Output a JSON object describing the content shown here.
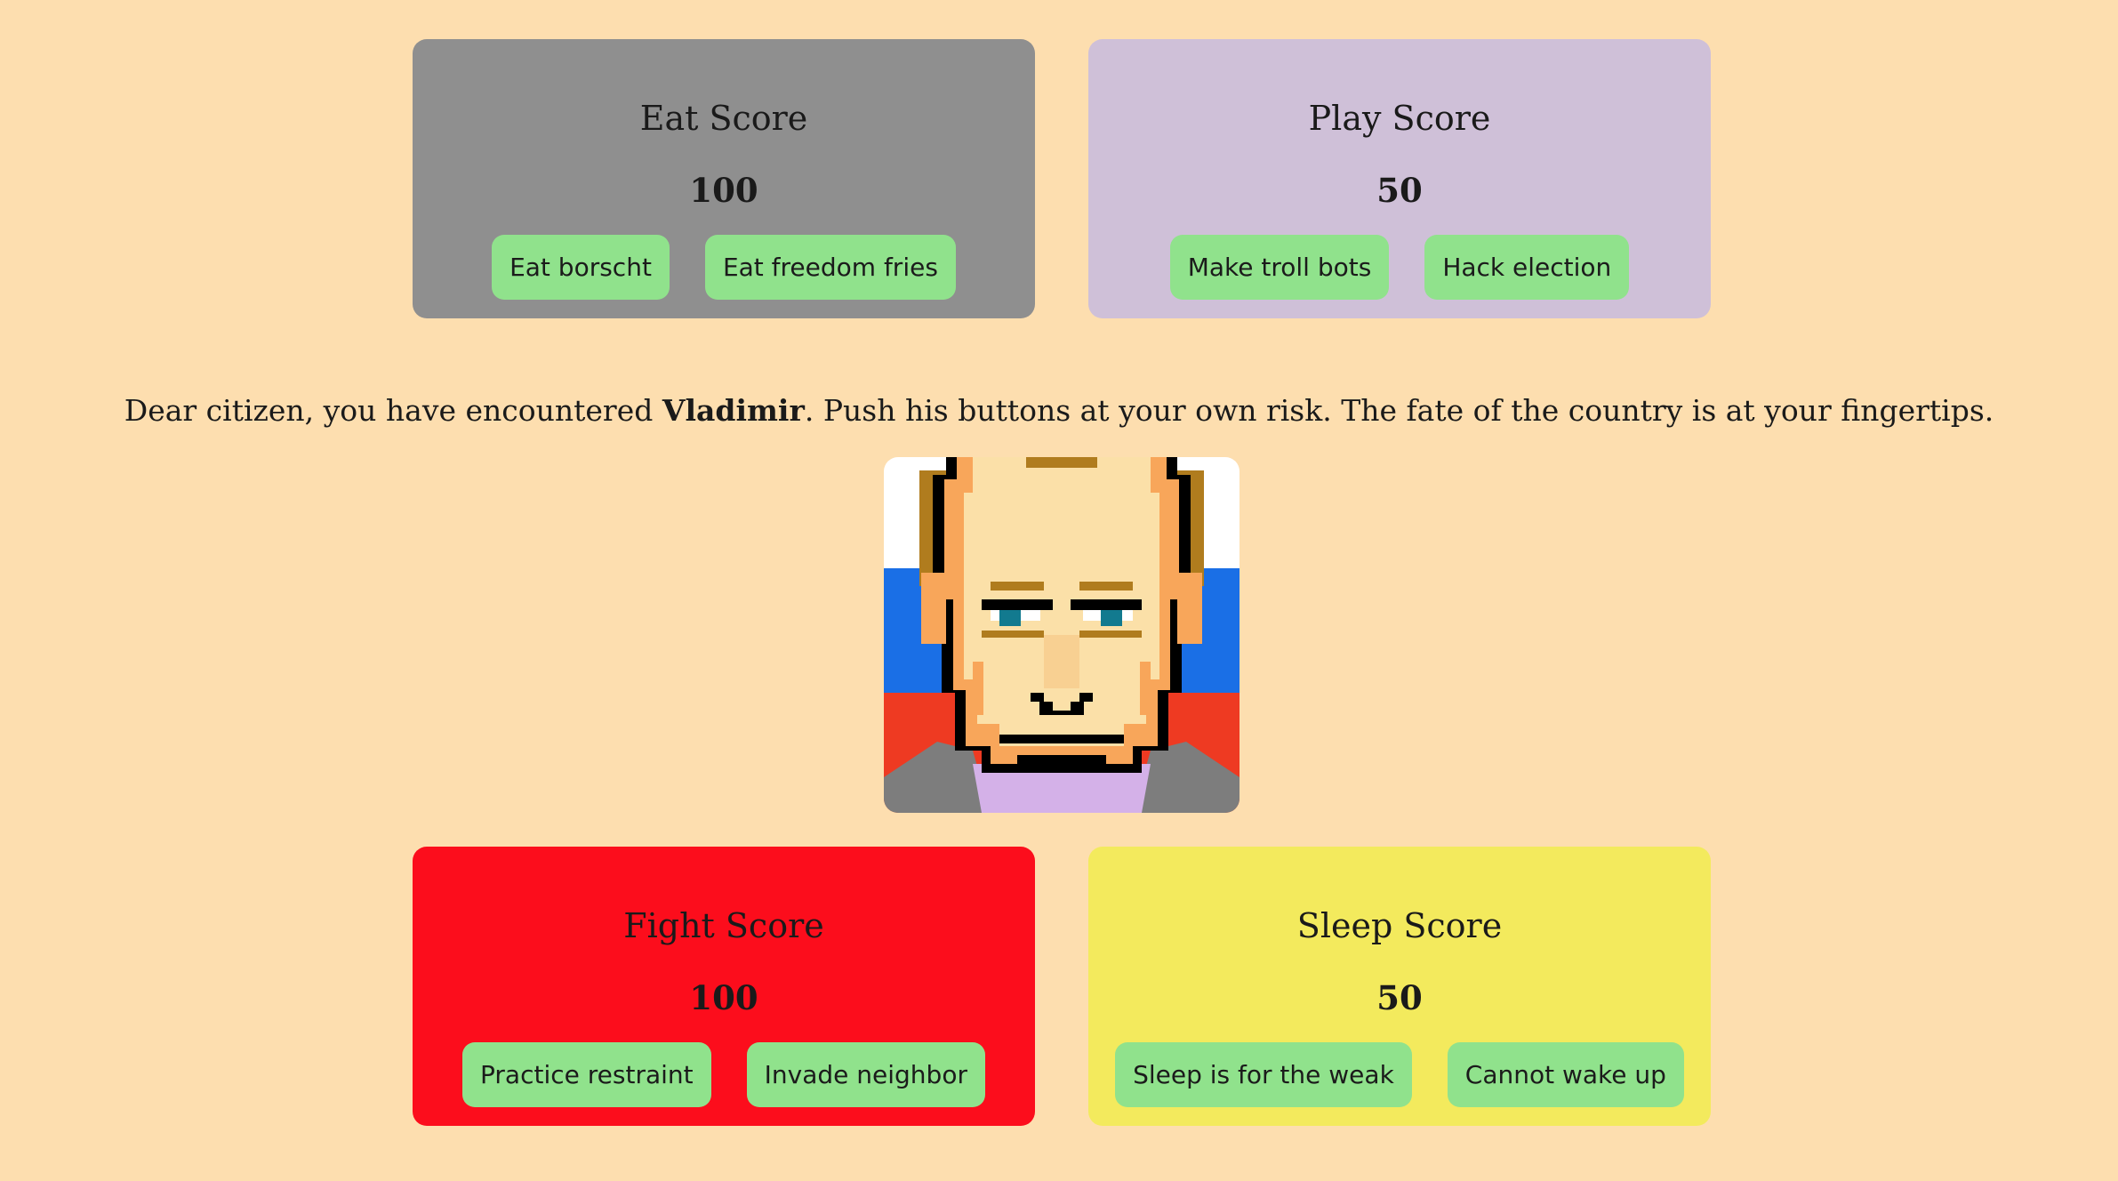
{
  "cards": [
    {
      "id": "eat",
      "title": "Eat Score",
      "score": "100",
      "color": "#8f8f8f",
      "buttons": [
        "Eat borscht",
        "Eat freedom fries"
      ]
    },
    {
      "id": "play",
      "title": "Play Score",
      "score": "50",
      "color": "#cfc0d8",
      "buttons": [
        "Make troll bots",
        "Hack election"
      ]
    },
    {
      "id": "fight",
      "title": "Fight Score",
      "score": "100",
      "color": "#fc0d1c",
      "buttons": [
        "Practice restraint",
        "Invade neighbor"
      ]
    },
    {
      "id": "sleep",
      "title": "Sleep Score",
      "score": "50",
      "color": "#f3ea5d",
      "buttons": [
        "Sleep is for the weak",
        "Cannot wake up"
      ]
    }
  ],
  "intro": {
    "before": "Dear citizen, you have encountered ",
    "name": "Vladimir",
    "after": ". Push his buttons at your own risk. The fate of the country is at your fingertips."
  },
  "portrait": {
    "icon": "pixel-portrait-vladimir",
    "colors": {
      "background": "#fddeaf",
      "button": "#90e28c",
      "flag_white": "#ffffff",
      "flag_blue": "#1a6fe6",
      "flag_red": "#ee3a22"
    }
  }
}
